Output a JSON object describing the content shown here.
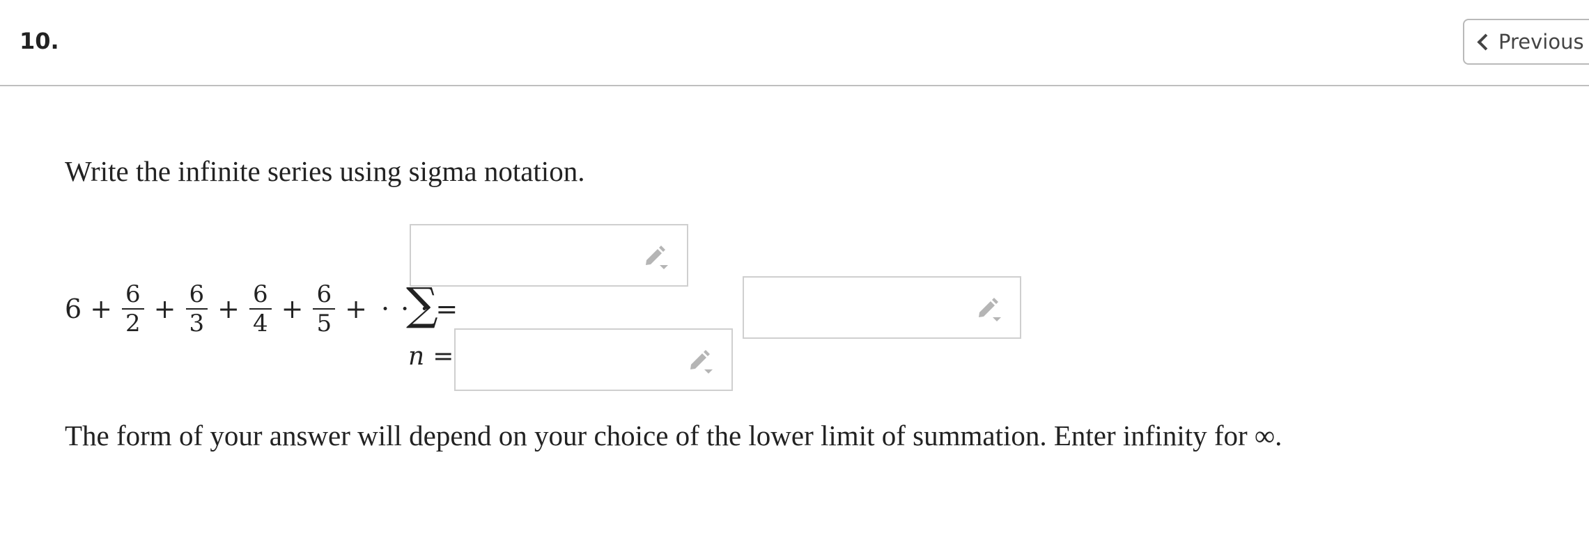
{
  "header": {
    "question_number": "10.",
    "previous_label": "Previous"
  },
  "question": {
    "instruction": "Write the infinite series using sigma notation.",
    "series": {
      "first_term": "6",
      "plus": "+",
      "fractions": [
        {
          "numerator": "6",
          "denominator": "2"
        },
        {
          "numerator": "6",
          "denominator": "3"
        },
        {
          "numerator": "6",
          "denominator": "4"
        },
        {
          "numerator": "6",
          "denominator": "5"
        }
      ],
      "ellipsis": "· · ·",
      "equals": "=",
      "sigma": "∑",
      "index_variable": "n",
      "index_equals": "="
    },
    "answer_fields": {
      "upper_limit": "",
      "general_term": "",
      "lower_limit": ""
    },
    "note": "The form of your answer will depend on your choice of the lower limit of summation. Enter infinity for ∞."
  },
  "icons": {
    "edit": "pencil-dropdown-icon",
    "previous": "chevron-left-icon"
  },
  "colors": {
    "text": "#222222",
    "border": "#cfcfcf",
    "icon": "#b5b5b5",
    "divider": "#bfbfbf"
  }
}
